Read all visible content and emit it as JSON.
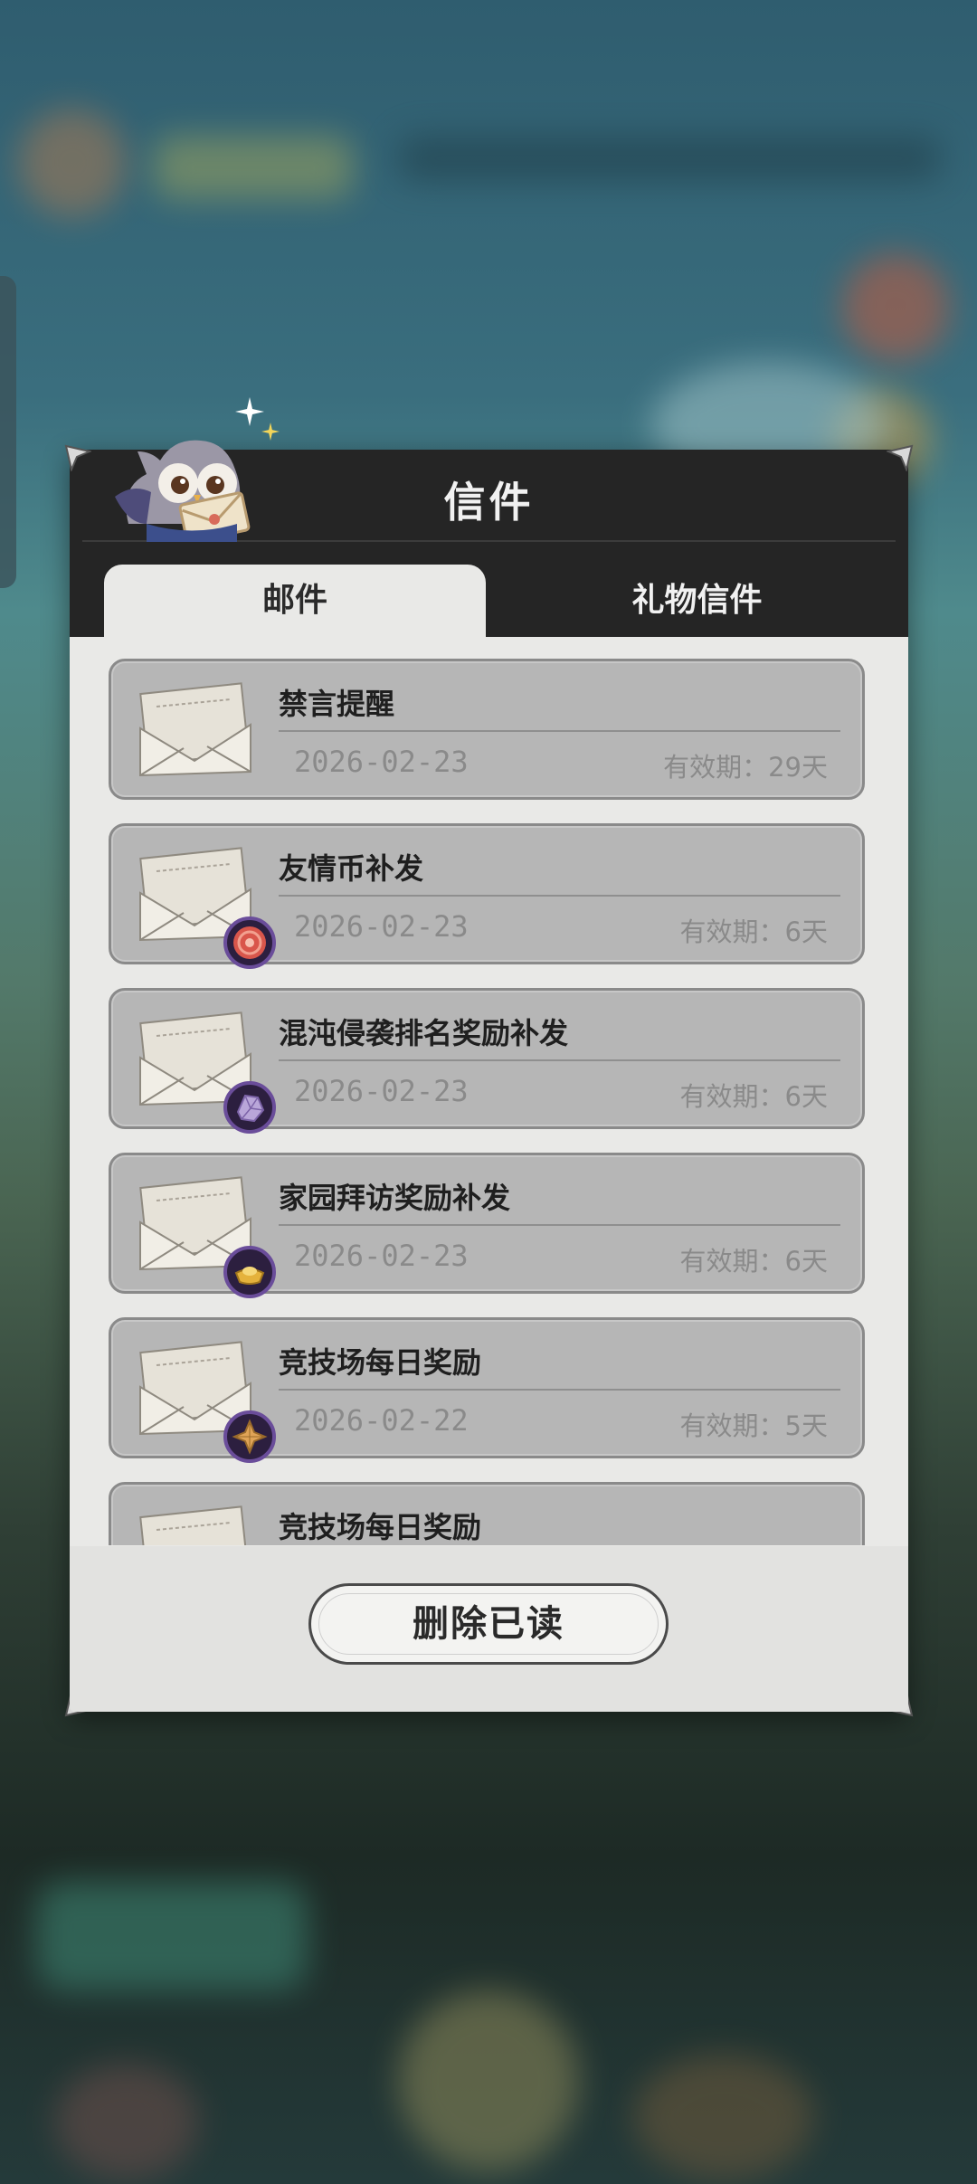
{
  "dialog": {
    "title": "信件",
    "tabs": [
      {
        "label": "邮件",
        "active": true
      },
      {
        "label": "礼物信件",
        "active": false
      }
    ],
    "mails": [
      {
        "title": "禁言提醒",
        "date": "2026-02-23",
        "validity": "有效期：29天",
        "attachment": "none"
      },
      {
        "title": "友情币补发",
        "date": "2026-02-23",
        "validity": "有效期：6天",
        "attachment": "friendship-coin-icon"
      },
      {
        "title": "混沌侵袭排名奖励补发",
        "date": "2026-02-23",
        "validity": "有效期：6天",
        "attachment": "crystal-icon"
      },
      {
        "title": "家园拜访奖励补发",
        "date": "2026-02-23",
        "validity": "有效期：6天",
        "attachment": "gold-ingot-icon"
      },
      {
        "title": "竞技场每日奖励",
        "date": "2026-02-22",
        "validity": "有效期：5天",
        "attachment": "star-crystal-icon"
      },
      {
        "title": "竞技场每日奖励",
        "date": "",
        "validity": "",
        "attachment": "none"
      }
    ],
    "delete_read_label": "删除已读"
  },
  "colors": {
    "header_bg": "#252525",
    "panel_bg": "#e9e9e7",
    "item_bg": "#b6b6b6",
    "text_dark": "#1f1f1f",
    "text_muted": "#8a8a8a"
  }
}
